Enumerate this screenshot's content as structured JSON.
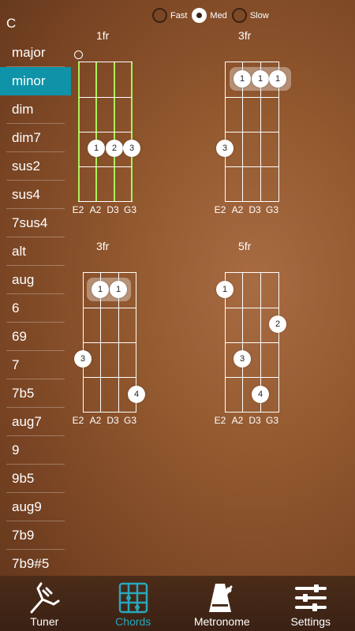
{
  "sidebar": {
    "root_note": "C",
    "chords": [
      "major",
      "minor",
      "dim",
      "dim7",
      "sus2",
      "sus4",
      "7sus4",
      "alt",
      "aug",
      "6",
      "69",
      "7",
      "7b5",
      "aug7",
      "9",
      "9b5",
      "aug9",
      "7b9",
      "7b9#5"
    ],
    "selected": "minor"
  },
  "speed": {
    "options": [
      "Fast",
      "Med",
      "Slow"
    ],
    "selected": "Med"
  },
  "diagrams": [
    {
      "fret_label": "1fr",
      "strings": [
        "E2",
        "A2",
        "D3",
        "G3"
      ]
    },
    {
      "fret_label": "3fr",
      "strings": [
        "E2",
        "A2",
        "D3",
        "G3"
      ]
    },
    {
      "fret_label": "3fr",
      "strings": [
        "E2",
        "A2",
        "D3",
        "G3"
      ]
    },
    {
      "fret_label": "5fr",
      "strings": [
        "E2",
        "A2",
        "D3",
        "G3"
      ]
    }
  ],
  "nav": {
    "tuner": "Tuner",
    "chords": "Chords",
    "metronome": "Metronome",
    "settings": "Settings",
    "active": "chords"
  },
  "colors": {
    "accent": "#0f93a8",
    "nav_active": "#28a7bd",
    "string_highlight": "#aaf05a"
  }
}
